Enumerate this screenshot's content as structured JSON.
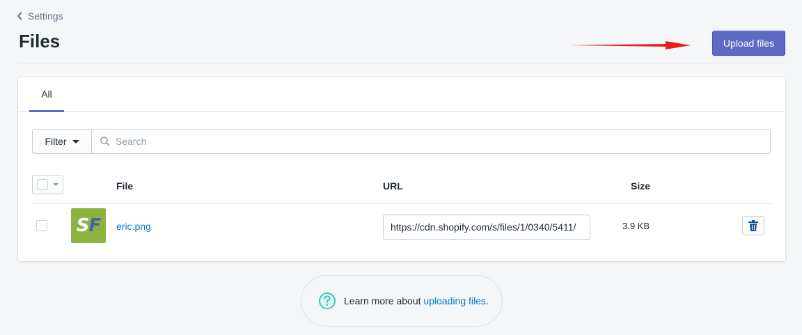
{
  "breadcrumb": {
    "label": "Settings"
  },
  "page": {
    "title": "Files"
  },
  "actions": {
    "upload_label": "Upload files"
  },
  "tabs": [
    {
      "label": "All",
      "active": true
    }
  ],
  "filter": {
    "label": "Filter",
    "search_placeholder": "Search",
    "search_value": ""
  },
  "table": {
    "columns": {
      "file": "File",
      "url": "URL",
      "size": "Size"
    },
    "rows": [
      {
        "thumbnail_text": [
          "S",
          "F"
        ],
        "file_name": "eric.png",
        "url": "https://cdn.shopify.com/s/files/1/0340/5411/",
        "size": "3.9 KB"
      }
    ]
  },
  "help": {
    "prefix": "Learn more about ",
    "link_text": "uploading files",
    "suffix": "."
  },
  "icons": {
    "back": "chevron-left-icon",
    "search": "search-icon",
    "delete": "trash-icon",
    "help": "question-circle-icon",
    "annotation": "red-arrow-icon"
  },
  "colors": {
    "accent": "#5c6ac4",
    "link": "#007ace",
    "annotation": "#ee1c1c",
    "help_icon": "#47c1bf",
    "thumbnail_bg": "#8db441"
  }
}
